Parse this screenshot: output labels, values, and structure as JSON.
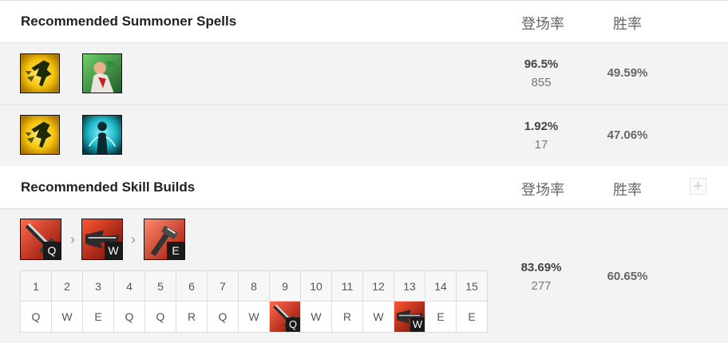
{
  "spells_section": {
    "title": "Recommended Summoner Spells",
    "col_pick": "登场率",
    "col_win": "胜率",
    "rows": [
      {
        "spells": [
          "flash-spell-icon",
          "heal-spell-icon"
        ],
        "pick_rate": "96.5%",
        "games": "855",
        "win_rate": "49.59%"
      },
      {
        "spells": [
          "flash-spell-icon",
          "cleanse-spell-icon"
        ],
        "pick_rate": "1.92%",
        "games": "17",
        "win_rate": "47.06%"
      }
    ]
  },
  "skills_section": {
    "title": "Recommended Skill Builds",
    "col_pick": "登场率",
    "col_win": "胜率",
    "add_label": "+",
    "build": {
      "priority": [
        {
          "key": "Q",
          "icon": "q-skill-icon"
        },
        {
          "key": "W",
          "icon": "w-skill-icon"
        },
        {
          "key": "E",
          "icon": "e-skill-icon"
        }
      ],
      "levels": [
        "1",
        "2",
        "3",
        "4",
        "5",
        "6",
        "7",
        "8",
        "9",
        "10",
        "11",
        "12",
        "13",
        "14",
        "15"
      ],
      "order": [
        {
          "v": "Q"
        },
        {
          "v": "W"
        },
        {
          "v": "E"
        },
        {
          "v": "Q"
        },
        {
          "v": "Q"
        },
        {
          "v": "R"
        },
        {
          "v": "Q"
        },
        {
          "v": "W"
        },
        {
          "v": "Q",
          "icon": "q-skill-icon"
        },
        {
          "v": "W"
        },
        {
          "v": "R"
        },
        {
          "v": "W"
        },
        {
          "v": "W",
          "icon": "w-skill-icon"
        },
        {
          "v": "E"
        },
        {
          "v": "E"
        }
      ],
      "pick_rate": "83.69%",
      "games": "277",
      "win_rate": "60.65%"
    }
  },
  "colors": {
    "flash": "#f4c20d",
    "heal": "#3aa84a",
    "cleanse": "#1fb9c8",
    "skill_red": "#d5261b"
  }
}
